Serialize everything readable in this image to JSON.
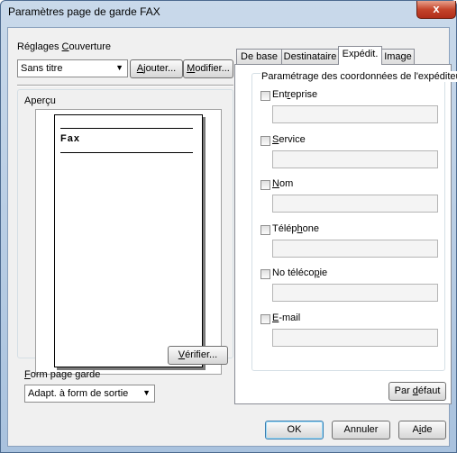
{
  "window": {
    "title": "Paramètres page de garde FAX",
    "close_glyph": "x"
  },
  "cover": {
    "group_label_pre": "Réglages ",
    "group_label_u": "C",
    "group_label_post": "ouverture",
    "selected": "Sans titre",
    "add_u": "A",
    "add_post": "jouter...",
    "modify_u": "M",
    "modify_post": "odifier..."
  },
  "preview": {
    "label": "Aperçu",
    "page_heading": "Fax",
    "verify_u": "V",
    "verify_post": "érifier..."
  },
  "form": {
    "label_u": "F",
    "label_post": "orm page garde",
    "selected": "Adapt. à form de sortie"
  },
  "tabs": [
    {
      "label": "De base"
    },
    {
      "label": "Destinataire"
    },
    {
      "label": "Expédit."
    },
    {
      "label": "Image"
    }
  ],
  "sender": {
    "group_title": "Paramétrage des coordonnées de l'expéditeur",
    "fields": [
      {
        "pre": "Ent",
        "u": "r",
        "post": "eprise",
        "value": ""
      },
      {
        "pre": "",
        "u": "S",
        "post": "ervice",
        "value": ""
      },
      {
        "pre": "",
        "u": "N",
        "post": "om",
        "value": ""
      },
      {
        "pre": "Télép",
        "u": "h",
        "post": "one",
        "value": ""
      },
      {
        "pre": "No téléco",
        "u": "p",
        "post": "ie",
        "value": ""
      },
      {
        "pre": "",
        "u": "E",
        "post": "-mail",
        "value": ""
      }
    ],
    "default_pre": "Par ",
    "default_u": "d",
    "default_post": "éfaut"
  },
  "footer": {
    "ok": "OK",
    "cancel": "Annuler",
    "help_pre": "A",
    "help_u": "i",
    "help_post": "de"
  }
}
